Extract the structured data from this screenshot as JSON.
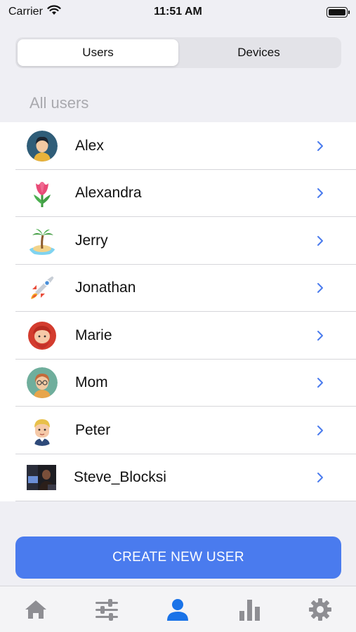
{
  "status_bar": {
    "carrier": "Carrier",
    "time": "11:51 AM"
  },
  "segmented_control": {
    "tabs": [
      {
        "label": "Users",
        "active": true
      },
      {
        "label": "Devices",
        "active": false
      }
    ]
  },
  "section": {
    "header": "All users"
  },
  "users": [
    {
      "name": "Alex",
      "avatar_icon": "person-dark-hair-icon"
    },
    {
      "name": "Alexandra",
      "avatar_icon": "tulip-icon"
    },
    {
      "name": "Jerry",
      "avatar_icon": "island-icon"
    },
    {
      "name": "Jonathan",
      "avatar_icon": "rocket-icon"
    },
    {
      "name": "Marie",
      "avatar_icon": "red-hair-woman-icon"
    },
    {
      "name": "Mom",
      "avatar_icon": "woman-glasses-icon"
    },
    {
      "name": "Peter",
      "avatar_icon": "blond-boy-icon"
    },
    {
      "name": "Steve_Blocksi",
      "avatar_icon": "photo-avatar-icon"
    }
  ],
  "create_button": {
    "label": "CREATE NEW USER"
  },
  "tab_bar": {
    "items": [
      {
        "icon": "home-icon",
        "active": false
      },
      {
        "icon": "sliders-icon",
        "active": false
      },
      {
        "icon": "user-icon",
        "active": true
      },
      {
        "icon": "bar-chart-icon",
        "active": false
      },
      {
        "icon": "gear-icon",
        "active": false
      }
    ]
  },
  "colors": {
    "accent": "#4a7bee",
    "active_tab": "#1a73e8",
    "inactive_tab": "#8e8e93",
    "chevron": "#4a7bee"
  }
}
